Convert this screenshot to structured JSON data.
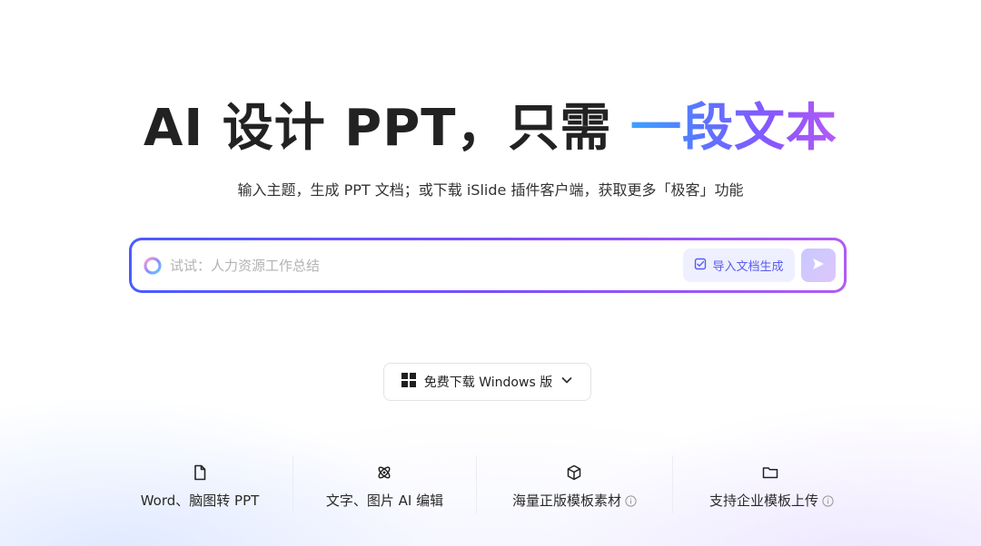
{
  "hero": {
    "title_plain": "AI 设计 PPT，只需 ",
    "title_highlight": "一段文本",
    "subtitle": "输入主题，生成 PPT 文档；或下载 iSlide 插件客户端，获取更多「极客」功能"
  },
  "search": {
    "placeholder": "试试：人力资源工作总结",
    "value": "",
    "import_label": "导入文档生成"
  },
  "download": {
    "label": "免费下载 Windows 版"
  },
  "features": [
    {
      "icon": "document-icon",
      "label": "Word、脑图转 PPT",
      "info": false
    },
    {
      "icon": "atom-icon",
      "label": "文字、图片 AI 编辑",
      "info": false
    },
    {
      "icon": "cube-icon",
      "label": "海量正版模板素材",
      "info": true
    },
    {
      "icon": "folder-icon",
      "label": "支持企业模板上传",
      "info": true
    }
  ],
  "colors": {
    "accent_gradient_start": "#3aa3ff",
    "accent_gradient_end": "#b35cf5",
    "search_border_start": "#4a5bff",
    "search_border_end": "#b05cf3",
    "import_text": "#5a5af0"
  }
}
